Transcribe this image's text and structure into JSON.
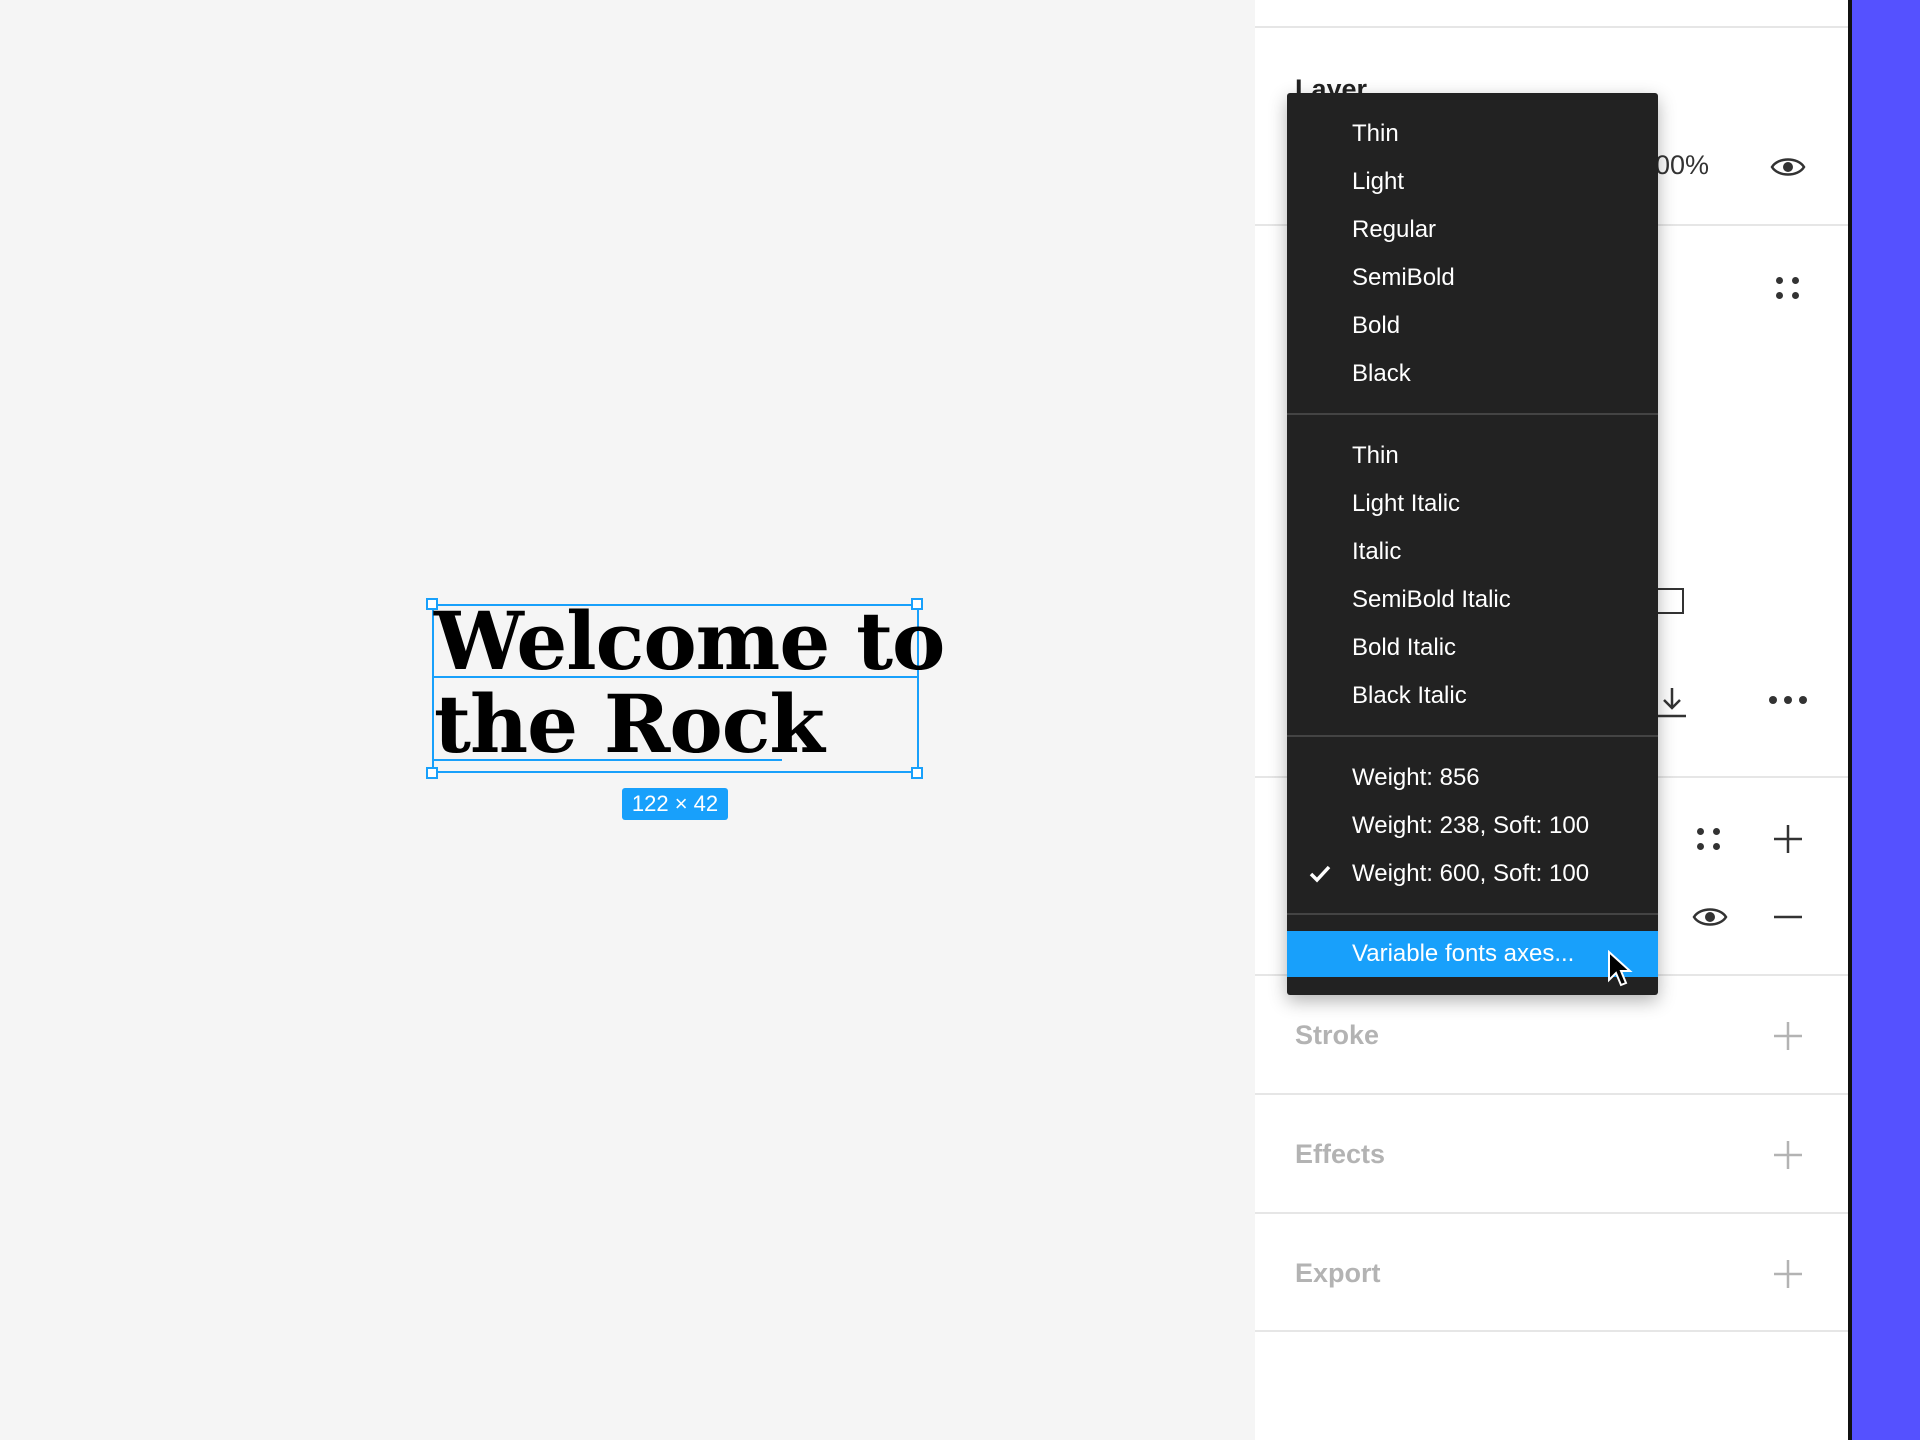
{
  "canvas": {
    "text": "Welcome to\nthe Rock",
    "dimensions": "122 × 42"
  },
  "panel": {
    "layer_heading": "Layer",
    "opacity_value": "100%",
    "sections": [
      {
        "label": "Stroke"
      },
      {
        "label": "Effects"
      },
      {
        "label": "Export"
      }
    ]
  },
  "font_style_menu": {
    "groups": [
      {
        "items": [
          "Thin",
          "Light",
          "Regular",
          "SemiBold",
          "Bold",
          "Black"
        ]
      },
      {
        "items": [
          "Thin",
          "Light Italic",
          "Italic",
          "SemiBold Italic",
          "Bold Italic",
          "Black Italic"
        ]
      },
      {
        "items": [
          "Weight: 856",
          "Weight: 238, Soft: 100",
          "Weight: 600, Soft: 100"
        ]
      }
    ],
    "selected": "Weight: 600, Soft: 100",
    "action": "Variable fonts axes..."
  },
  "colors": {
    "selection": "#18a0fb",
    "menu_bg": "#222222",
    "accent_strip": "#5551ff"
  },
  "icons": [
    "eye-icon",
    "drag-handle-icon",
    "plus-icon",
    "minus-icon",
    "download-icon",
    "more-icon",
    "checkmark-icon",
    "cursor-icon"
  ]
}
